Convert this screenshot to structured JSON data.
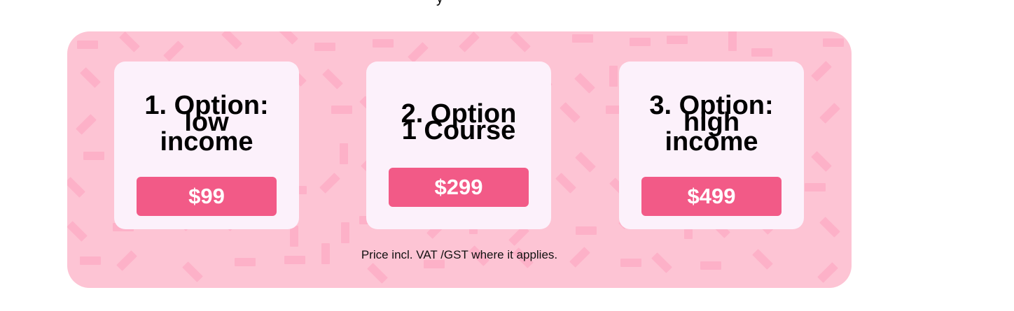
{
  "header": {
    "partial_glyph": "y"
  },
  "pricing": {
    "options": [
      {
        "title_lines": [
          "1. Option:",
          "low",
          "income"
        ],
        "price": "$99"
      },
      {
        "title_lines": [
          "2. Option",
          "1 Course"
        ],
        "price": "$299"
      },
      {
        "title_lines": [
          "3. Option:",
          "high",
          "income"
        ],
        "price": "$499"
      }
    ],
    "footnote": "Price incl. VAT /GST where it applies."
  },
  "colors": {
    "panel_background": "#fdc4d4",
    "confetti": "#fdb1c8",
    "card_background": "#fcf1fb",
    "button": "#f25a87",
    "button_text": "#ffffff"
  },
  "icons": {
    "background_pattern": "confetti-pattern"
  }
}
